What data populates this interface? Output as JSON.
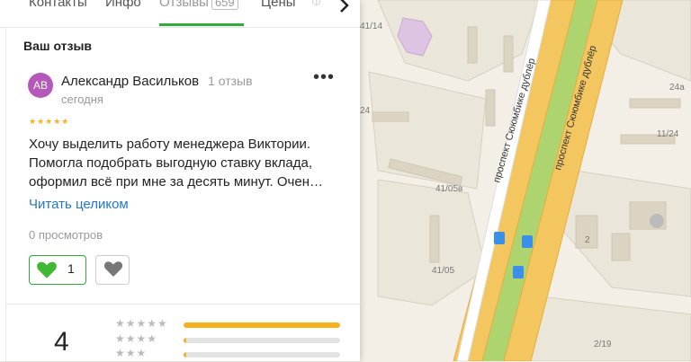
{
  "tabs": {
    "contacts": "Контакты",
    "info": "Инфо",
    "reviews": "Отзывы",
    "reviews_count": "659",
    "prices": "Цены",
    "next_icon": "chevron-right-icon"
  },
  "review_section": {
    "title": "Ваш отзыв"
  },
  "review": {
    "avatar_initials": "АВ",
    "avatar_color": "#b658b9",
    "author": "Александр Васильков",
    "author_reviews": "1 отзыв",
    "date": "сегодня",
    "stars": "★★★★★",
    "text": "Хочу выделить работу менеджера Виктории. Помогла подобрать выгодную ставку вклада, оформил всё при мне за десять минут. Очен…",
    "read_more": "Читать целиком",
    "views": "0 просмотров",
    "likes": "1",
    "like_icon": "green-heart-icon",
    "dislike_icon": "broken-heart-icon"
  },
  "rating": {
    "value": "4",
    "distribution": [
      {
        "stars": "★★★★★",
        "fraction": 1.0
      },
      {
        "stars": "★★★★",
        "fraction": 0.02
      },
      {
        "stars": "★★★",
        "fraction": 0.02
      }
    ]
  },
  "map": {
    "labels": [
      "41/14",
      "24",
      "24a",
      "11/24",
      "41/05в",
      "41/05",
      "2",
      "2/19"
    ],
    "street_labels": [
      "проспект Сююмбике дублёр",
      "проспект Сююмбике дублёр"
    ]
  },
  "colors": {
    "accent": "#2fad3a",
    "link": "#2277cc",
    "star": "#f6b11c",
    "road": "#f3c65f",
    "park": "#aed46f"
  }
}
